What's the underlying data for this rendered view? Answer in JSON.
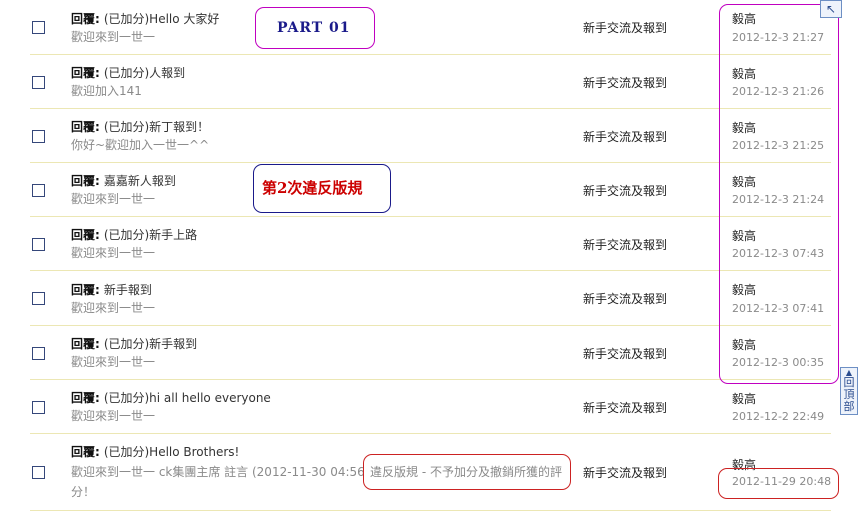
{
  "rows": [
    {
      "prefix": "回覆:",
      "title": "(已加分)Hello 大家好",
      "summary": "歡迎來到一世一",
      "forum": "新手交流及報到",
      "author": "毅高",
      "time": "2012-12-3 21:27"
    },
    {
      "prefix": "回覆:",
      "title": "(已加分)人報到",
      "summary": "歡迎加入141",
      "forum": "新手交流及報到",
      "author": "毅高",
      "time": "2012-12-3 21:26"
    },
    {
      "prefix": "回覆:",
      "title": "(已加分)新丁報到！",
      "summary": "你好~歡迎加入一世一^^",
      "forum": "新手交流及報到",
      "author": "毅高",
      "time": "2012-12-3 21:25"
    },
    {
      "prefix": "回覆:",
      "title": "嘉嘉新人報到",
      "summary": "歡迎來到一世一",
      "forum": "新手交流及報到",
      "author": "毅高",
      "time": "2012-12-3 21:24"
    },
    {
      "prefix": "回覆:",
      "title": "(已加分)新手上路",
      "summary": "歡迎來到一世一",
      "forum": "新手交流及報到",
      "author": "毅高",
      "time": "2012-12-3 07:43"
    },
    {
      "prefix": "回覆:",
      "title": "新手報到",
      "summary": "歡迎來到一世一",
      "forum": "新手交流及報到",
      "author": "毅高",
      "time": "2012-12-3 07:41"
    },
    {
      "prefix": "回覆:",
      "title": "(已加分)新手報到",
      "summary": "歡迎來到一世一",
      "forum": "新手交流及報到",
      "author": "毅高",
      "time": "2012-12-3 00:35"
    },
    {
      "prefix": "回覆:",
      "title": "(已加分)hi all hello everyone",
      "summary": "歡迎來到一世一",
      "forum": "新手交流及報到",
      "author": "毅高",
      "time": "2012-12-2 22:49"
    },
    {
      "prefix": "回覆:",
      "title": "(已加分)Hello Brothers!",
      "summary": "歡迎來到一世一 ck集團主席 註言 (2012-11-30 04:56):",
      "summary_cont": "分！",
      "forum": "新手交流及報到",
      "author": "毅高",
      "time": "2012-11-29 20:48"
    }
  ],
  "annotations": {
    "part": "PART 01",
    "violation": "第2次違反版規",
    "violation_note": "違反版規 - 不予加分及撤銷所獲的評"
  },
  "controls": {
    "back_top": "回頂部",
    "back_top_arrow": "▲",
    "corner_icon": "↖"
  },
  "colors": {
    "row_divider": "#ece7b4",
    "magenta_box": "#c000c0",
    "red_box": "#cc2222",
    "navy_box": "#1a1a8a"
  }
}
